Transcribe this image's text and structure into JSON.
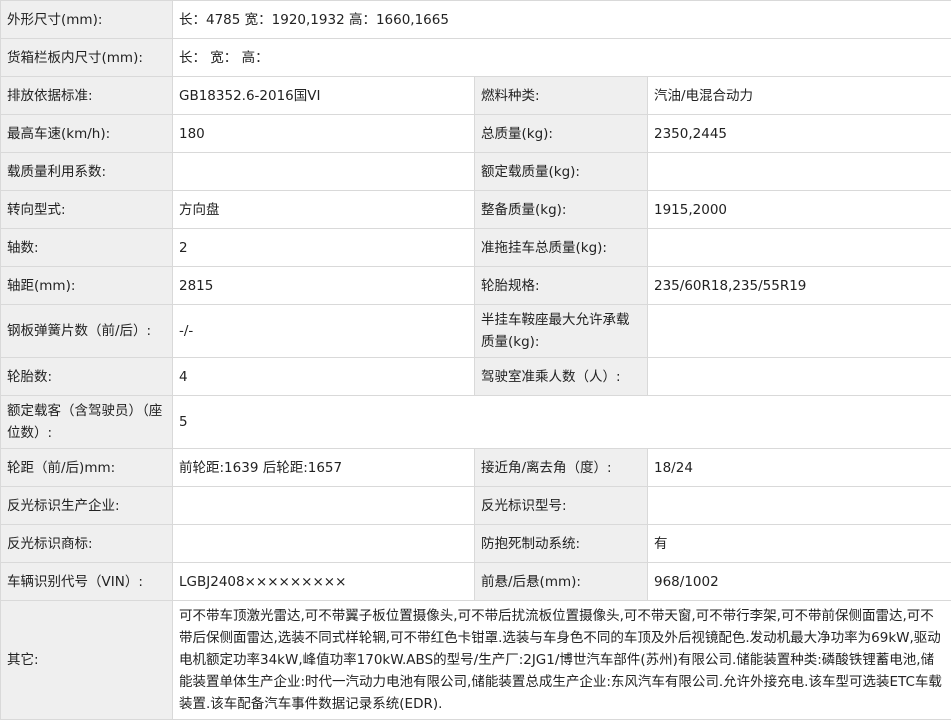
{
  "rows": {
    "dims": {
      "label": "外形尺寸(mm):",
      "value": "长：4785 宽：1920,1932 高：1660,1665"
    },
    "cargo": {
      "label": "货箱栏板内尺寸(mm):",
      "value": "长： 宽： 高："
    },
    "r3": {
      "l1": "排放依据标准:",
      "v1": "GB18352.6-2016国VI",
      "l2": "燃料种类:",
      "v2": "汽油/电混合动力"
    },
    "r4": {
      "l1": "最高车速(km/h):",
      "v1": "180",
      "l2": "总质量(kg):",
      "v2": "2350,2445"
    },
    "r5": {
      "l1": "载质量利用系数:",
      "v1": "",
      "l2": "额定载质量(kg):",
      "v2": ""
    },
    "r6": {
      "l1": "转向型式:",
      "v1": "方向盘",
      "l2": "整备质量(kg):",
      "v2": "1915,2000"
    },
    "r7": {
      "l1": "轴数:",
      "v1": "2",
      "l2": "准拖挂车总质量(kg):",
      "v2": ""
    },
    "r8": {
      "l1": "轴距(mm):",
      "v1": "2815",
      "l2": "轮胎规格:",
      "v2": "235/60R18,235/55R19"
    },
    "r9": {
      "l1": "钢板弹簧片数（前/后）:",
      "v1": "-/-",
      "l2": "半挂车鞍座最大允许承载质量(kg):",
      "v2": ""
    },
    "r10": {
      "l1": "轮胎数:",
      "v1": "4",
      "l2": "驾驶室准乘人数（人）:",
      "v2": ""
    },
    "r11": {
      "l1": "额定载客（含驾驶员）（座位数）:",
      "v1": "5"
    },
    "r12": {
      "l1": "轮距（前/后)mm:",
      "v1": "前轮距:1639 后轮距:1657",
      "l2": "接近角/离去角（度）:",
      "v2": "18/24"
    },
    "r13": {
      "l1": "反光标识生产企业:",
      "v1": "",
      "l2": "反光标识型号:",
      "v2": ""
    },
    "r14": {
      "l1": "反光标识商标:",
      "v1": "",
      "l2": "防抱死制动系统:",
      "v2": "有"
    },
    "r15": {
      "l1": "车辆识别代号（VIN）:",
      "v1": "LGBJ2408×××××××××",
      "l2": "前悬/后悬(mm):",
      "v2": "968/1002"
    },
    "other": {
      "label": "其它:",
      "value": "可不带车顶激光雷达,可不带翼子板位置摄像头,可不带后扰流板位置摄像头,可不带天窗,可不带行李架,可不带前保侧面雷达,可不带后保侧面雷达,选装不同式样轮辋,可不带红色卡钳罩.选装与车身色不同的车顶及外后视镜配色.发动机最大净功率为69kW,驱动电机额定功率34kW,峰值功率170kW.ABS的型号/生产厂:2JG1/博世汽车部件(苏州)有限公司.储能装置种类:磷酸铁锂蓄电池,储能装置单体生产企业:时代一汽动力电池有限公司,储能装置总成生产企业:东风汽车有限公司.允许外接充电.该车型可选装ETC车载装置.该车配备汽车事件数据记录系统(EDR)."
    }
  }
}
